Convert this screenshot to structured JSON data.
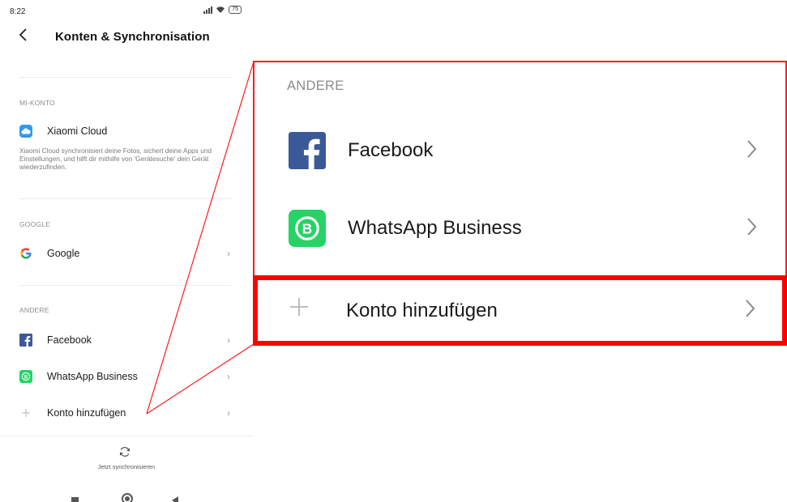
{
  "status_bar": {
    "time": "8:22",
    "battery": "75"
  },
  "header": {
    "title": "Konten & Synchronisation"
  },
  "sections": {
    "mi_account": {
      "label": "MI-KONTO",
      "item_label": "Xiaomi Cloud",
      "description": "Xiaomi Cloud synchronisiert deine Fotos, sichert deine Apps und Einstellungen, und hilft dir mithilfe von 'Gerätesuche' dein Gerät wiederzufinden."
    },
    "google": {
      "label": "GOOGLE",
      "item_label": "Google"
    },
    "other": {
      "label": "ANDERE",
      "items": [
        {
          "label": "Facebook",
          "icon": "facebook-icon"
        },
        {
          "label": "WhatsApp Business",
          "icon": "whatsapp-business-icon"
        }
      ],
      "add_account": "Konto hinzufügen"
    }
  },
  "sync": {
    "label": "Jetzt synchronisieren"
  },
  "zoom": {
    "section_label": "ANDERE",
    "facebook": "Facebook",
    "whatsapp": "WhatsApp Business",
    "add_account": "Konto hinzufügen"
  },
  "colors": {
    "highlight": "#ff0000",
    "facebook": "#3b5998",
    "whatsapp": "#25d366",
    "xiaomi_cloud": "#2e9bf0",
    "section_label": "#8c8c8c"
  }
}
